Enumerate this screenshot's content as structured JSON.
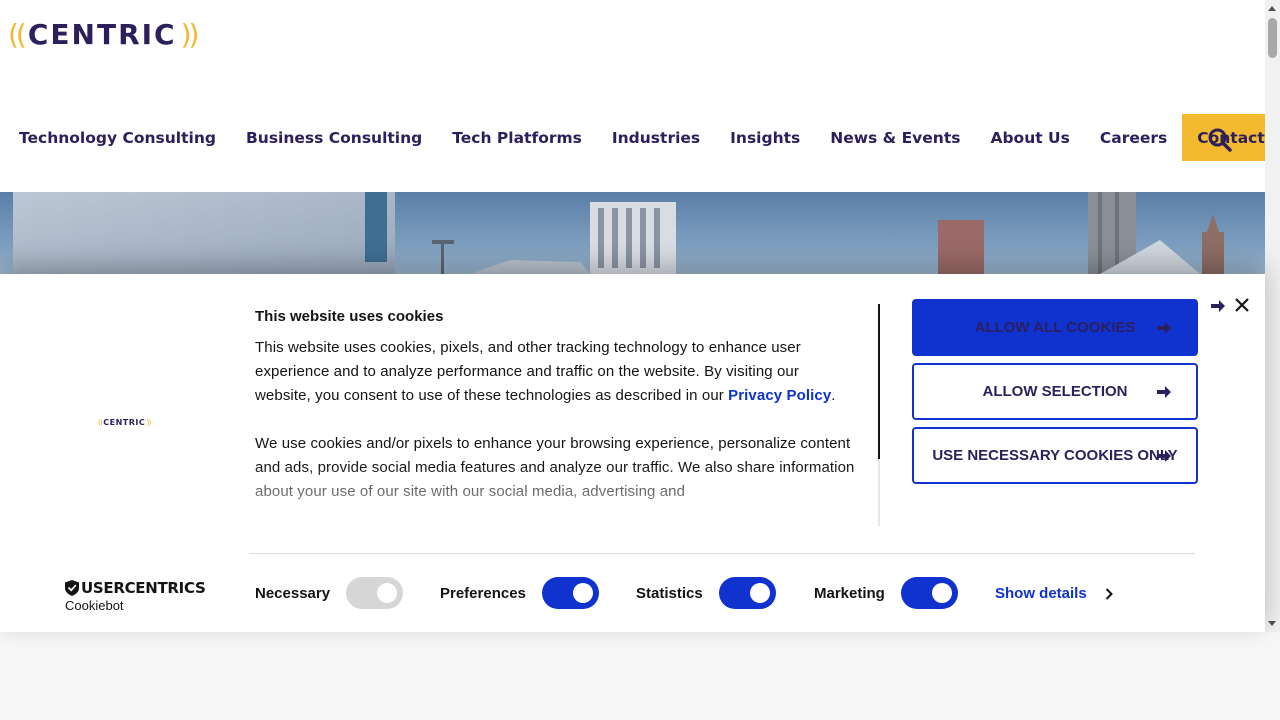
{
  "brand": {
    "name": "CENTRIC",
    "paren_left": "((",
    "paren_right": "))"
  },
  "colors": {
    "brand_navy": "#2c1f5c",
    "brand_yellow": "#f3b92f",
    "cookie_blue": "#1032cf"
  },
  "nav": {
    "items": [
      "Technology Consulting",
      "Business Consulting",
      "Tech Platforms",
      "Industries",
      "Insights",
      "News & Events",
      "About Us",
      "Careers"
    ],
    "contact_label": "Contact Us",
    "search_icon": "search-icon"
  },
  "cookie_banner": {
    "title": "This website uses cookies",
    "paragraph1_before": "This website uses cookies, pixels, and other tracking technology to enhance user experience and to analyze performance and traffic on the website. By visiting our website, you consent to use of these technologies as described in our ",
    "privacy_link": "Privacy Policy",
    "paragraph1_after": ".",
    "paragraph2": "We use cookies and/or pixels to enhance your browsing experience, personalize content and ads, provide social media features and analyze our traffic. We also share information about your use of our site with our social media, advertising and",
    "buttons": {
      "allow_all": "ALLOW ALL COOKIES",
      "allow_selection": "ALLOW SELECTION",
      "necessary_only": "USE NECESSARY COOKIES ONLY"
    },
    "brand": {
      "name": "USERCENTRICS",
      "sub": "Cookiebot"
    },
    "toggles": [
      {
        "label": "Necessary",
        "checked": true,
        "disabled": true
      },
      {
        "label": "Preferences",
        "checked": true,
        "disabled": false
      },
      {
        "label": "Statistics",
        "checked": true,
        "disabled": false
      },
      {
        "label": "Marketing",
        "checked": true,
        "disabled": false
      }
    ],
    "show_details": "Show details"
  }
}
